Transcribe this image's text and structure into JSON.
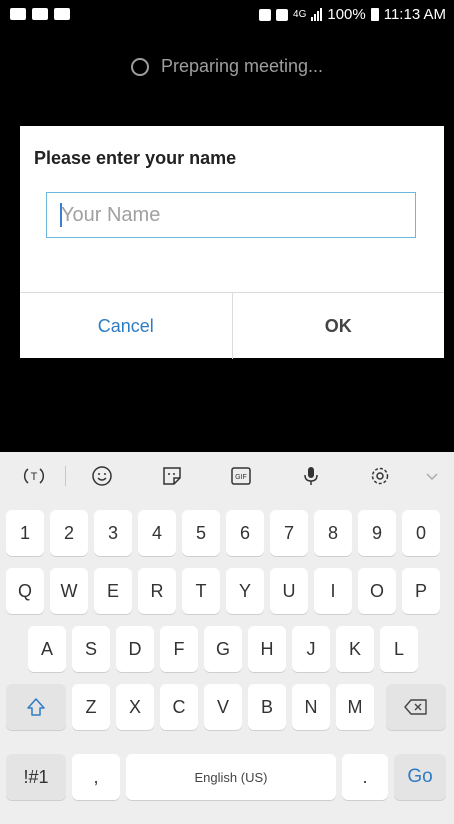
{
  "status_bar": {
    "network": "4G",
    "battery": "100%",
    "time": "11:13 AM"
  },
  "preparing_text": "Preparing meeting...",
  "dialog": {
    "title": "Please enter your name",
    "input_placeholder": "Your Name",
    "input_value": "",
    "cancel_label": "Cancel",
    "ok_label": "OK"
  },
  "keyboard_toolbar": {
    "items": [
      "text-recognition-icon",
      "emoji-icon",
      "sticker-icon",
      "gif-icon",
      "microphone-icon",
      "settings-icon",
      "chevron-down-icon"
    ]
  },
  "keyboard": {
    "number_row": [
      "1",
      "2",
      "3",
      "4",
      "5",
      "6",
      "7",
      "8",
      "9",
      "0"
    ],
    "row1": [
      "Q",
      "W",
      "E",
      "R",
      "T",
      "Y",
      "U",
      "I",
      "O",
      "P"
    ],
    "row2": [
      "A",
      "S",
      "D",
      "F",
      "G",
      "H",
      "J",
      "K",
      "L"
    ],
    "row3": [
      "Z",
      "X",
      "C",
      "V",
      "B",
      "N",
      "M"
    ],
    "symbols_label": "!#1",
    "comma_label": ",",
    "space_label": "English (US)",
    "period_label": ".",
    "go_label": "Go"
  },
  "colors": {
    "accent": "#2e7cc4",
    "input_border": "#6fb6dc"
  }
}
